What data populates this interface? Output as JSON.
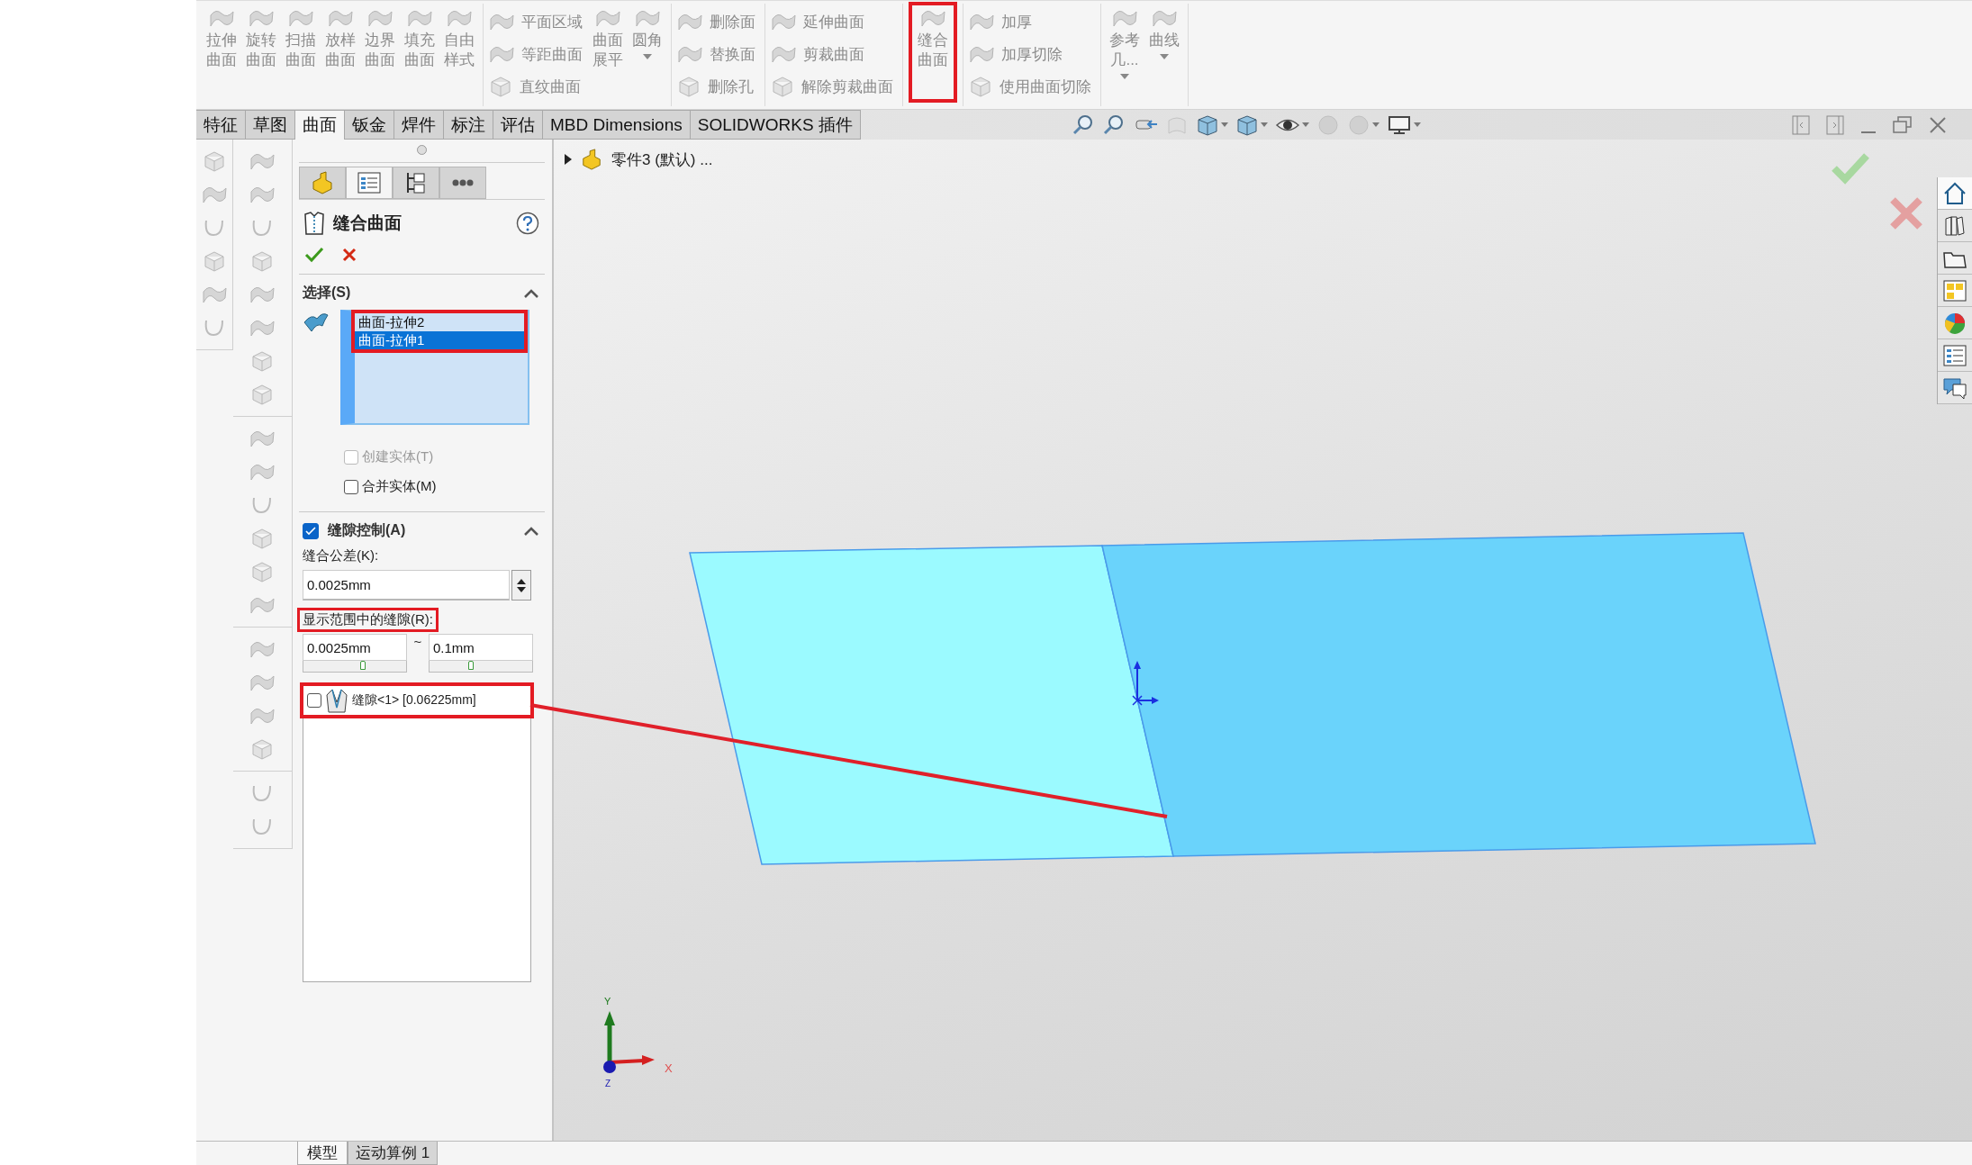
{
  "toolbar": {
    "groups": [
      {
        "items": [
          {
            "kind": "large",
            "label": "拉伸曲面",
            "menu": false,
            "annotated": false
          },
          {
            "kind": "large",
            "label": "旋转曲面",
            "menu": false,
            "annotated": false
          },
          {
            "kind": "large",
            "label": "扫描曲面",
            "menu": false,
            "annotated": false
          },
          {
            "kind": "large",
            "label": "放样曲面",
            "menu": false,
            "annotated": false
          },
          {
            "kind": "large",
            "label": "边界曲面",
            "menu": false,
            "annotated": false
          },
          {
            "kind": "large",
            "label": "填充曲面",
            "menu": false,
            "annotated": false
          },
          {
            "kind": "large",
            "label": "自由样式",
            "menu": false,
            "annotated": false
          }
        ]
      },
      {
        "items": [
          {
            "kind": "stack",
            "buttons": [
              {
                "label": "平面区域"
              },
              {
                "label": "等距曲面"
              },
              {
                "label": "直纹曲面"
              }
            ]
          },
          {
            "kind": "large",
            "label": "曲面展平",
            "menu": false,
            "annotated": false
          },
          {
            "kind": "large",
            "label": "圆角",
            "menu": true,
            "annotated": false
          }
        ]
      },
      {
        "items": [
          {
            "kind": "stack",
            "buttons": [
              {
                "label": "删除面"
              },
              {
                "label": "替换面"
              },
              {
                "label": "删除孔"
              }
            ]
          }
        ]
      },
      {
        "items": [
          {
            "kind": "stack",
            "buttons": [
              {
                "label": "延伸曲面"
              },
              {
                "label": "剪裁曲面"
              },
              {
                "label": "解除剪裁曲面"
              }
            ]
          }
        ]
      },
      {
        "items": [
          {
            "kind": "large",
            "label": "缝合曲面",
            "menu": false,
            "annotated": true
          }
        ]
      },
      {
        "items": [
          {
            "kind": "stack",
            "buttons": [
              {
                "label": "加厚"
              },
              {
                "label": "加厚切除"
              },
              {
                "label": "使用曲面切除"
              }
            ]
          }
        ]
      },
      {
        "items": [
          {
            "kind": "large",
            "label": "参考几...",
            "menu": true,
            "annotated": false
          },
          {
            "kind": "large",
            "label": "曲线",
            "menu": true,
            "annotated": false
          }
        ]
      }
    ]
  },
  "tabs": [
    {
      "label": "特征",
      "selected": false
    },
    {
      "label": "草图",
      "selected": false
    },
    {
      "label": "曲面",
      "selected": true
    },
    {
      "label": "钣金",
      "selected": false
    },
    {
      "label": "焊件",
      "selected": false
    },
    {
      "label": "标注",
      "selected": false
    },
    {
      "label": "评估",
      "selected": false
    },
    {
      "label": "MBD Dimensions",
      "selected": false
    },
    {
      "label": "SOLIDWORKS 插件",
      "selected": false
    }
  ],
  "property_manager": {
    "tabs": [
      {
        "selected": false
      },
      {
        "selected": true
      },
      {
        "selected": false
      },
      {
        "selected": false
      }
    ],
    "title": "缝合曲面",
    "selection": {
      "title": "选择(S)",
      "expanded": true,
      "annotated": true,
      "items": [
        {
          "label": "曲面-拉伸2",
          "selected": false
        },
        {
          "label": "曲面-拉伸1",
          "selected": true
        }
      ]
    },
    "options": [
      {
        "label": "创建实体(T)",
        "checked": false,
        "disabled": true
      },
      {
        "label": "合并实体(M)",
        "checked": false,
        "disabled": false
      }
    ],
    "gap_control": {
      "title": "缝隙控制(A)",
      "checked": true,
      "expanded": true,
      "tolerance_label": "缝合公差(K):",
      "tolerance": "0.0025mm",
      "range_label": "显示范围中的缝隙(R):",
      "range_annotated": true,
      "range_min": {
        "value": "0.0025mm",
        "level": 0.58
      },
      "range_separator": "~",
      "range_max": {
        "value": "0.1mm",
        "level": 0.4
      },
      "gaps": [
        {
          "label": "缝隙<1> [0.06225mm]",
          "checked": false,
          "annotated": true
        }
      ]
    }
  },
  "tree": {
    "root": "零件3 (默认) ..."
  },
  "triad": {
    "x_label": "X",
    "y_label": "Y",
    "z_label": "Z"
  },
  "bottom_tabs": [
    {
      "label": "模型",
      "selected": true
    },
    {
      "label": "运动算例 1",
      "selected": false
    }
  ]
}
